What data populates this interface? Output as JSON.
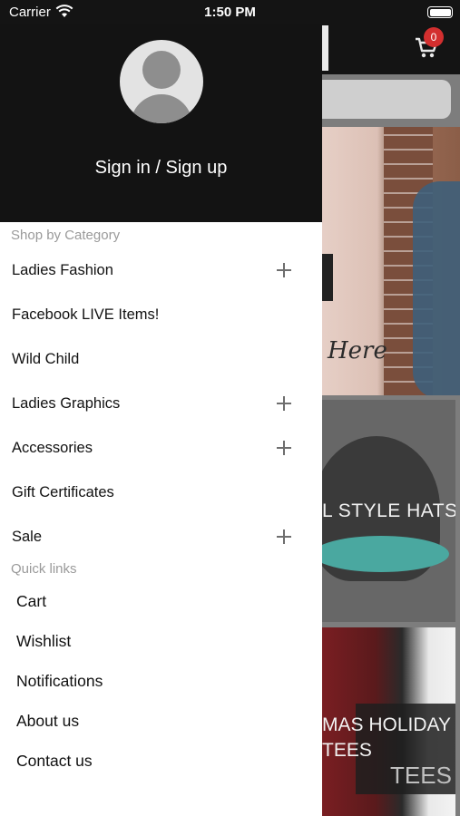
{
  "status_bar": {
    "carrier": "Carrier",
    "time": "1:50 PM",
    "wifi_icon": "wifi-icon",
    "battery_icon": "battery-icon"
  },
  "background_app": {
    "cart": {
      "icon": "cart-icon",
      "badge_count": "0",
      "badge_color": "#d32f2f"
    },
    "banner_here_text": "Here",
    "banner_hats_text": "L STYLE HATS",
    "banner_xmas_line1": "MAS HOLIDAY",
    "banner_xmas_line2": "TEES",
    "banner_xmas_line3": "TEES"
  },
  "drawer": {
    "avatar_icon": "user-avatar-icon",
    "signin_label": "Sign in / Sign up",
    "shop_section_title": "Shop by Category",
    "categories": [
      {
        "label": "Ladies Fashion",
        "expandable": true
      },
      {
        "label": "Facebook LIVE Items!",
        "expandable": false
      },
      {
        "label": "Wild Child",
        "expandable": false
      },
      {
        "label": "Ladies Graphics",
        "expandable": true
      },
      {
        "label": "Accessories",
        "expandable": true
      },
      {
        "label": "Gift Certificates",
        "expandable": false
      },
      {
        "label": "Sale",
        "expandable": true
      }
    ],
    "quick_section_title": "Quick links",
    "quick_links": [
      {
        "label": "Cart"
      },
      {
        "label": "Wishlist"
      },
      {
        "label": "Notifications"
      },
      {
        "label": "About us"
      },
      {
        "label": "Contact us"
      }
    ]
  },
  "colors": {
    "header_bg": "#131313",
    "drawer_bg": "#ffffff",
    "section_title": "#9a9a9a",
    "badge": "#d32f2f"
  }
}
